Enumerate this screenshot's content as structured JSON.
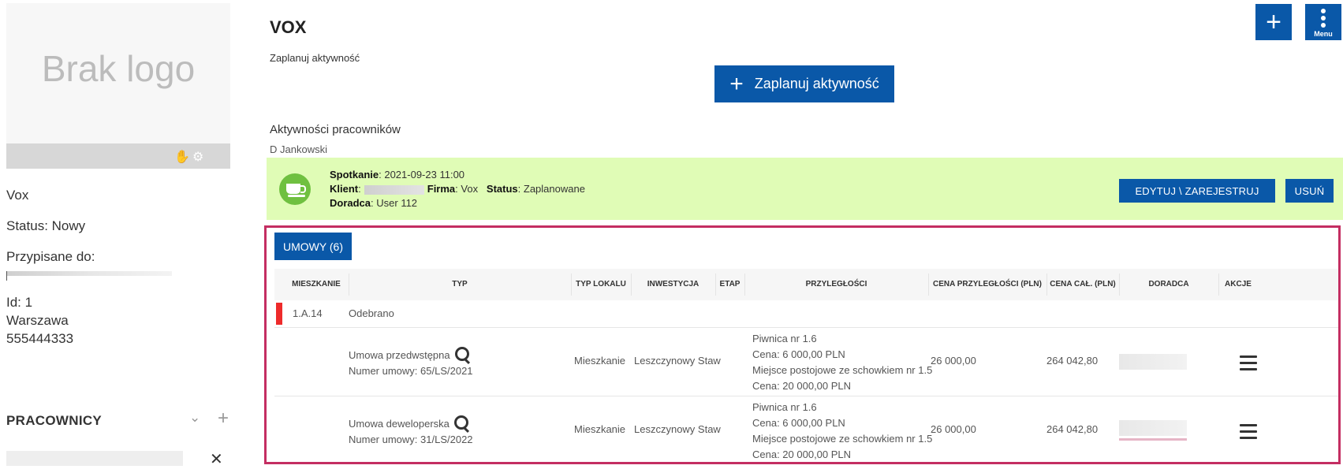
{
  "sidebar": {
    "logo_text": "Brak logo",
    "name": "Vox",
    "status": "Status: Nowy",
    "assigned_label": "Przypisane do:",
    "id_line": "Id: 1",
    "city": "Warszawa",
    "phone": "555444333",
    "employees_title": "PRACOWNICY"
  },
  "header": {
    "title": "VOX",
    "menu_label": "Menu"
  },
  "plan": {
    "section_label": "Zaplanuj aktywność",
    "button_label": "Zaplanuj aktywność"
  },
  "activities": {
    "section_label": "Aktywności pracowników",
    "employee": "D Jankowski",
    "item": {
      "type_label": "Spotkanie",
      "datetime": ": 2021-09-23 11:00",
      "client_label": "Klient",
      "client_sep": ":",
      "company_label": "Firma",
      "company_value": ": Vox",
      "status_label": "Status",
      "status_value": ": Zaplanowane",
      "advisor_label": "Doradca",
      "advisor_value": ": User 112",
      "edit_label": "EDYTUJ \\ ZAREJESTRUJ",
      "delete_label": "USUŃ"
    }
  },
  "contracts": {
    "tab_label": "UMOWY (6)",
    "columns": [
      "MIESZKANIE",
      "TYP",
      "TYP LOKALU",
      "INWESTYCJA",
      "ETAP",
      "PRZYLEGŁOŚCI",
      "CENA PRZYLEGŁOŚCI (PLN)",
      "CENA CAŁ. (PLN)",
      "DORADCA",
      "AKCJE"
    ],
    "group": {
      "unit": "1.A.14",
      "status": "Odebrano",
      "marker_color": "#ee2b2b"
    },
    "rows": [
      {
        "type": "Umowa przedwstępna",
        "number": "Numer umowy: 65/LS/2021",
        "unit_type": "Mieszkanie",
        "investment": "Leszczynowy Staw",
        "adjacent": [
          "Piwnica nr 1.6",
          "Cena: 6 000,00 PLN",
          "Miejsce postojowe ze schowkiem nr 1.5",
          "Cena: 20 000,00 PLN"
        ],
        "adjacent_price": "26 000,00",
        "total_price": "264 042,80"
      },
      {
        "type": "Umowa deweloperska",
        "number": "Numer umowy: 31/LS/2022",
        "unit_type": "Mieszkanie",
        "investment": "Leszczynowy Staw",
        "adjacent": [
          "Piwnica nr 1.6",
          "Cena: 6 000,00 PLN",
          "Miejsce postojowe ze schowkiem nr 1.5",
          "Cena: 20 000,00 PLN"
        ],
        "adjacent_price": "26 000,00",
        "total_price": "264 042,80"
      }
    ]
  },
  "colors": {
    "primary": "#0a58a8",
    "activity_bg": "#e0fcb6",
    "activity_icon": "#6fc040",
    "highlight_border": "#c42e62"
  }
}
